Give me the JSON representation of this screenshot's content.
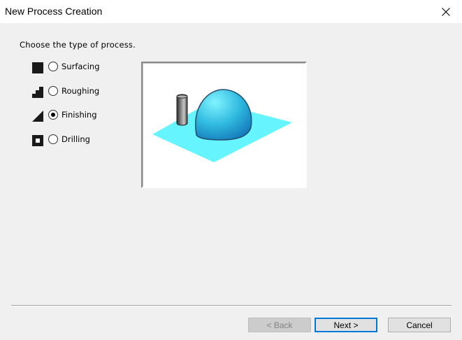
{
  "window": {
    "title": "New Process Creation"
  },
  "prompt": "Choose the type of process.",
  "process_types": [
    {
      "label": "Surfacing",
      "icon": "surfacing-icon",
      "selected": false
    },
    {
      "label": "Roughing",
      "icon": "roughing-icon",
      "selected": false
    },
    {
      "label": "Finishing",
      "icon": "finishing-icon",
      "selected": true
    },
    {
      "label": "Drilling",
      "icon": "drilling-icon",
      "selected": false
    }
  ],
  "preview": {
    "illustration": "finishing-preview",
    "colors": {
      "plane": "#66f5ff",
      "dome": "#2fb6dd",
      "tool": "#555555"
    }
  },
  "buttons": {
    "back": "< Back",
    "next": "Next >",
    "cancel": "Cancel"
  },
  "colors": {
    "accent": "#0078d7",
    "dialog_bg": "#f0f0f0"
  }
}
